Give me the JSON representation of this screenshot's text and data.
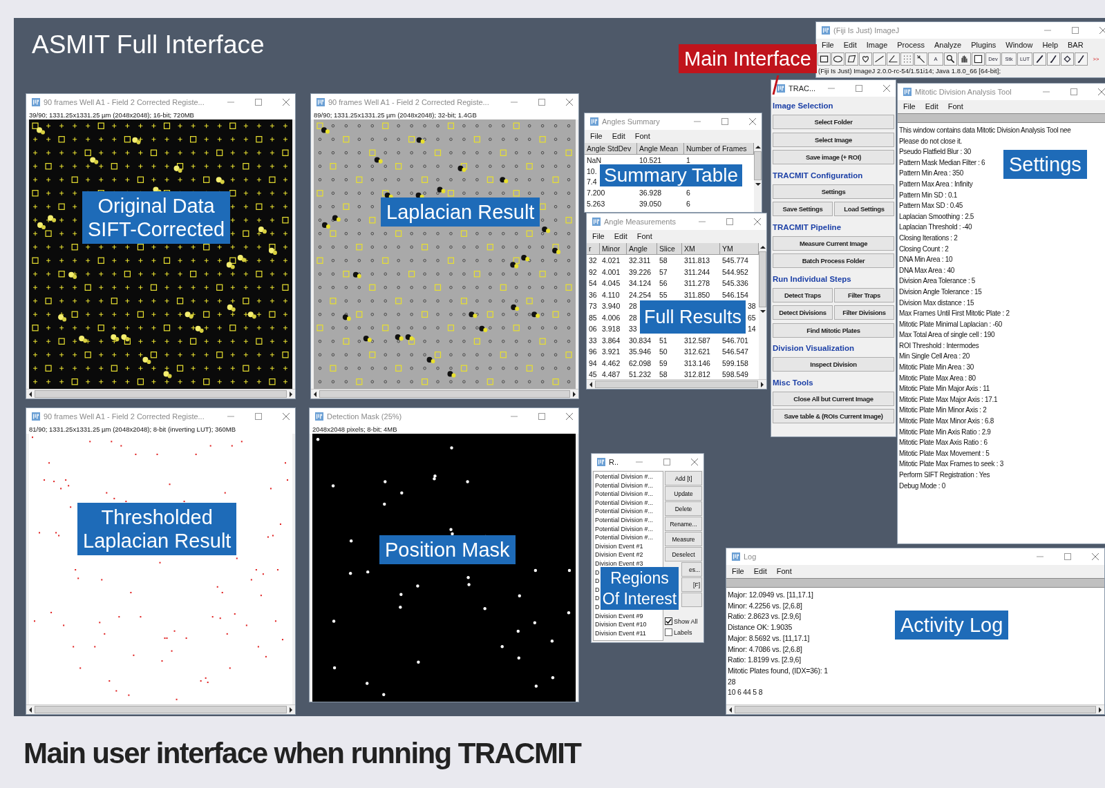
{
  "figure_title": "ASMIT Full Interface",
  "image_windows": [
    {
      "title": "90 frames Well A1 - Field 2 Corrected Registe...",
      "info": "39/90; 1331.25x1331.25 µm (2048x2048); 16-bit; 720MB",
      "kind": "crosses",
      "scrollbar": true
    },
    {
      "title": "90 frames Well A1 - Field 2 Corrected Registe...",
      "info": "89/90; 1331.25x1331.25 µm (2048x2048); 32-bit; 1.4GB",
      "kind": "laplacian",
      "scrollbar": true
    },
    {
      "title": "90 frames Well A1 - Field 2 Corrected Registe...",
      "info": "81/90; 1331.25x1331.25 µm (2048x2048); 8-bit (inverting LUT); 360MB",
      "kind": "threshold",
      "scrollbar": true
    },
    {
      "title": "Detection Mask (25%)",
      "info": "2048x2048 pixels; 8-bit; 4MB",
      "kind": "mask",
      "scrollbar": false
    }
  ],
  "angles_summary": {
    "title": "Angles Summary",
    "menu": [
      "File",
      "Edit",
      "Font"
    ],
    "columns": [
      "Angle StdDev",
      "Angle Mean",
      "Number of Frames"
    ],
    "rows": [
      [
        "NaN",
        "10.521",
        "1"
      ],
      [
        "10.",
        null,
        null
      ],
      [
        "7.4",
        null,
        null
      ],
      [
        "7.200",
        "36.928",
        "6"
      ],
      [
        "5.263",
        "39.050",
        "6"
      ]
    ]
  },
  "angle_measurements": {
    "title": "Angle Measurements",
    "menu": [
      "File",
      "Edit",
      "Font"
    ],
    "columns": [
      "r",
      "Minor",
      "Angle",
      "Slice",
      "XM",
      "YM"
    ],
    "rows": [
      [
        "32",
        "4.021",
        "32.311",
        "58",
        "311.813",
        "545.774"
      ],
      [
        "92",
        "4.001",
        "39.226",
        "57",
        "311.244",
        "544.952"
      ],
      [
        "54",
        "4.045",
        "34.124",
        "56",
        "311.278",
        "545.336"
      ],
      [
        "36",
        "4.110",
        "24.254",
        "55",
        "311.850",
        "546.154"
      ],
      [
        "73",
        "3.940",
        "28",
        null,
        null,
        "38"
      ],
      [
        "85",
        "4.006",
        "28",
        null,
        null,
        "65"
      ],
      [
        "06",
        "3.918",
        "33",
        null,
        null,
        "14"
      ],
      [
        "33",
        "3.864",
        "30.834",
        "51",
        "312.587",
        "546.701"
      ],
      [
        "96",
        "3.921",
        "35.946",
        "50",
        "312.621",
        "546.547"
      ],
      [
        "94",
        "4.462",
        "62.098",
        "59",
        "313.146",
        "599.158"
      ],
      [
        "45",
        "4.487",
        "51.232",
        "58",
        "312.812",
        "598.549"
      ]
    ]
  },
  "tracmit_panel": {
    "title": "TRAC...",
    "sections": [
      {
        "heading": "Image Selection",
        "rows": [
          [
            "Select Folder"
          ],
          [
            "Select Image"
          ],
          [
            "Save image (+ ROI)"
          ]
        ]
      },
      {
        "heading": "TRACMIT Configuration",
        "rows": [
          [
            "Settings"
          ],
          [
            "Save Settings",
            "Load Settings"
          ]
        ]
      },
      {
        "heading": "TRACMIT Pipeline",
        "rows": [
          [
            "Measure Current Image"
          ],
          [
            "Batch Process Folder"
          ]
        ]
      },
      {
        "heading": "Run Individual Steps",
        "rows": [
          [
            "Detect Traps",
            "Filter Traps"
          ],
          [
            "Detect Divisions",
            "Filter Divisions"
          ],
          [
            "Find Mitotic Plates"
          ]
        ]
      },
      {
        "heading": "Division Visualization",
        "rows": [
          [
            "Inspect Division"
          ]
        ]
      },
      {
        "heading": "Misc Tools",
        "rows": [
          [
            "Close All but Current Image"
          ],
          [
            "Save table & (ROIs Current Image)"
          ]
        ]
      }
    ]
  },
  "imagej_main": {
    "title": "(Fiji Is Just) ImageJ",
    "menu": [
      "File",
      "Edit",
      "Image",
      "Process",
      "Analyze",
      "Plugins",
      "Window",
      "Help",
      "BAR"
    ],
    "tool_text": [
      "A",
      "Dev",
      "Stk",
      "LUT",
      ">>"
    ],
    "status": "(Fiji Is Just) ImageJ 2.0.0-rc-54/1.51i14; Java 1.8.0_66 [64-bit];"
  },
  "settings_window": {
    "title": "Mitotic Division Analysis Tool",
    "menu": [
      "File",
      "Edit",
      "Font"
    ],
    "lines": [
      "This window contains data Mitotic Division Analysis Tool nee",
      "Please do not close it.",
      "Pseudo Flatfield Blur : 30",
      "Pattern Mask Median Filter : 6",
      "Pattern Min Area : 350",
      "Pattern Max Area : Infinity",
      "Pattern Min SD : 0.1",
      "Pattern Max SD : 0.45",
      "Laplacian Smoothing : 2.5",
      "Laplacian Threshold : -40",
      "Closing Iterations : 2",
      "Closing Count : 2",
      "DNA Min Area : 10",
      "DNA Max Area : 40",
      "Division Area Tolerance : 5",
      "Division Angle Tolerance : 15",
      "Division Max distance : 15",
      "Max Frames Until First Mitotic Plate : 2",
      "Mitotic Plate Minimal Laplacian : -60",
      "Max Total Area of single cell : 190",
      "ROI Threshold : Intermodes",
      "Min Single Cell Area : 20",
      "Mitotic Plate Min Area : 30",
      "Mitotic Plate Max Area : 80",
      "Mitotic Plate Min Major Axis : 11",
      "Mitotic Plate Max Major Axis : 17.1",
      "Mitotic Plate Min Minor Axis : 2",
      "Mitotic Plate Max Minor Axis : 6.8",
      "Mitotic Plate Min Axis Ratio : 2.9",
      "Mitotic Plate Max Axis Ratio : 6",
      "Mitotic Plate Max Movement : 5",
      "Mitotic Plate Max Frames to seek : 3",
      "Perform SIFT Registration : Yes",
      "Debug Mode : 0"
    ]
  },
  "roi_manager": {
    "title": "R..",
    "items": [
      "Potential Division #...",
      "Potential Division #...",
      "Potential Division #...",
      "Potential Division #...",
      "Potential Division #...",
      "Potential Division #...",
      "Potential Division #...",
      "Potential Division #...",
      "Division Event #1",
      "Division Event #2",
      "Division Event #3",
      "D",
      "D",
      "D",
      "D",
      "D",
      "Division Event #9",
      "Division Event #10",
      "Division Event #11"
    ],
    "buttons": [
      "Add [t]",
      "Update",
      "Delete",
      "Rename...",
      "Measure",
      "Deselect",
      "es...",
      "[F]"
    ],
    "options": [
      {
        "label": "Show All",
        "checked": true
      },
      {
        "label": "Labels",
        "checked": false
      }
    ]
  },
  "log_window": {
    "title": "Log",
    "menu": [
      "File",
      "Edit",
      "Font"
    ],
    "lines": [
      "Major: 12.0949 vs. [11,17.1]",
      "Minor: 4.2256 vs. [2,6.8]",
      "Ratio: 2.8623 vs. [2.9,6]",
      "Distance OK: 1.9035",
      "Major: 8.5692 vs. [11,17.1]",
      "Minor: 4.7086 vs. [2,6.8]",
      "Ratio: 1.8199 vs. [2.9,6]",
      "Mitotic Plates found, (IDX=36): 1",
      "28",
      "10 6 44 5 8"
    ]
  },
  "callouts": [
    {
      "kind": "note",
      "lines": [
        "Original Data",
        "SIFT-Corrected"
      ]
    },
    {
      "kind": "note",
      "lines": [
        "Laplacian Result"
      ]
    },
    {
      "kind": "note",
      "lines": [
        "Summary Table"
      ]
    },
    {
      "kind": "note",
      "lines": [
        "Full Results"
      ]
    },
    {
      "kind": "note",
      "lines": [
        "Settings"
      ]
    },
    {
      "kind": "note",
      "lines": [
        "Thresholded",
        "Laplacian Result"
      ]
    },
    {
      "kind": "note",
      "lines": [
        "Position Mask"
      ]
    },
    {
      "kind": "note",
      "lines": [
        "Regions",
        "Of Interest"
      ]
    },
    {
      "kind": "note",
      "lines": [
        "Activity Log"
      ]
    },
    {
      "kind": "pointer",
      "lines": [
        "Main Interface"
      ]
    }
  ],
  "caption": "Main user interface when running TRACMIT"
}
